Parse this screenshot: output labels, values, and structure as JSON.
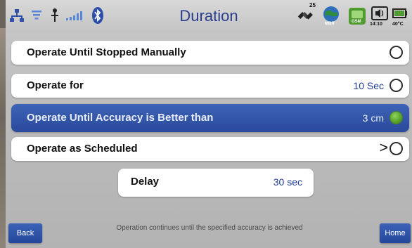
{
  "header": {
    "title": "Duration",
    "status": {
      "satellite_count": "25",
      "signal_label": "MBR",
      "gsm_label": "GSM",
      "time": "14:10",
      "temperature": "40°C"
    }
  },
  "options": [
    {
      "label": "Operate Until Stopped Manually",
      "value": "",
      "selected": false
    },
    {
      "label": "Operate for",
      "value": "10 Sec",
      "selected": false
    },
    {
      "label": "Operate Until Accuracy is Better than",
      "value": "3 cm",
      "selected": true
    },
    {
      "label": "Operate as Scheduled",
      "value": "",
      "selected": false
    }
  ],
  "delay": {
    "label": "Delay",
    "value": "30 sec"
  },
  "footer": {
    "note": "Operation continues until the specified accuracy is achieved",
    "back_label": "Back",
    "home_label": "Home"
  },
  "colors": {
    "accent": "#2a4a9b",
    "title": "#2a3e8c",
    "selected_radio": "#5aa42c"
  }
}
